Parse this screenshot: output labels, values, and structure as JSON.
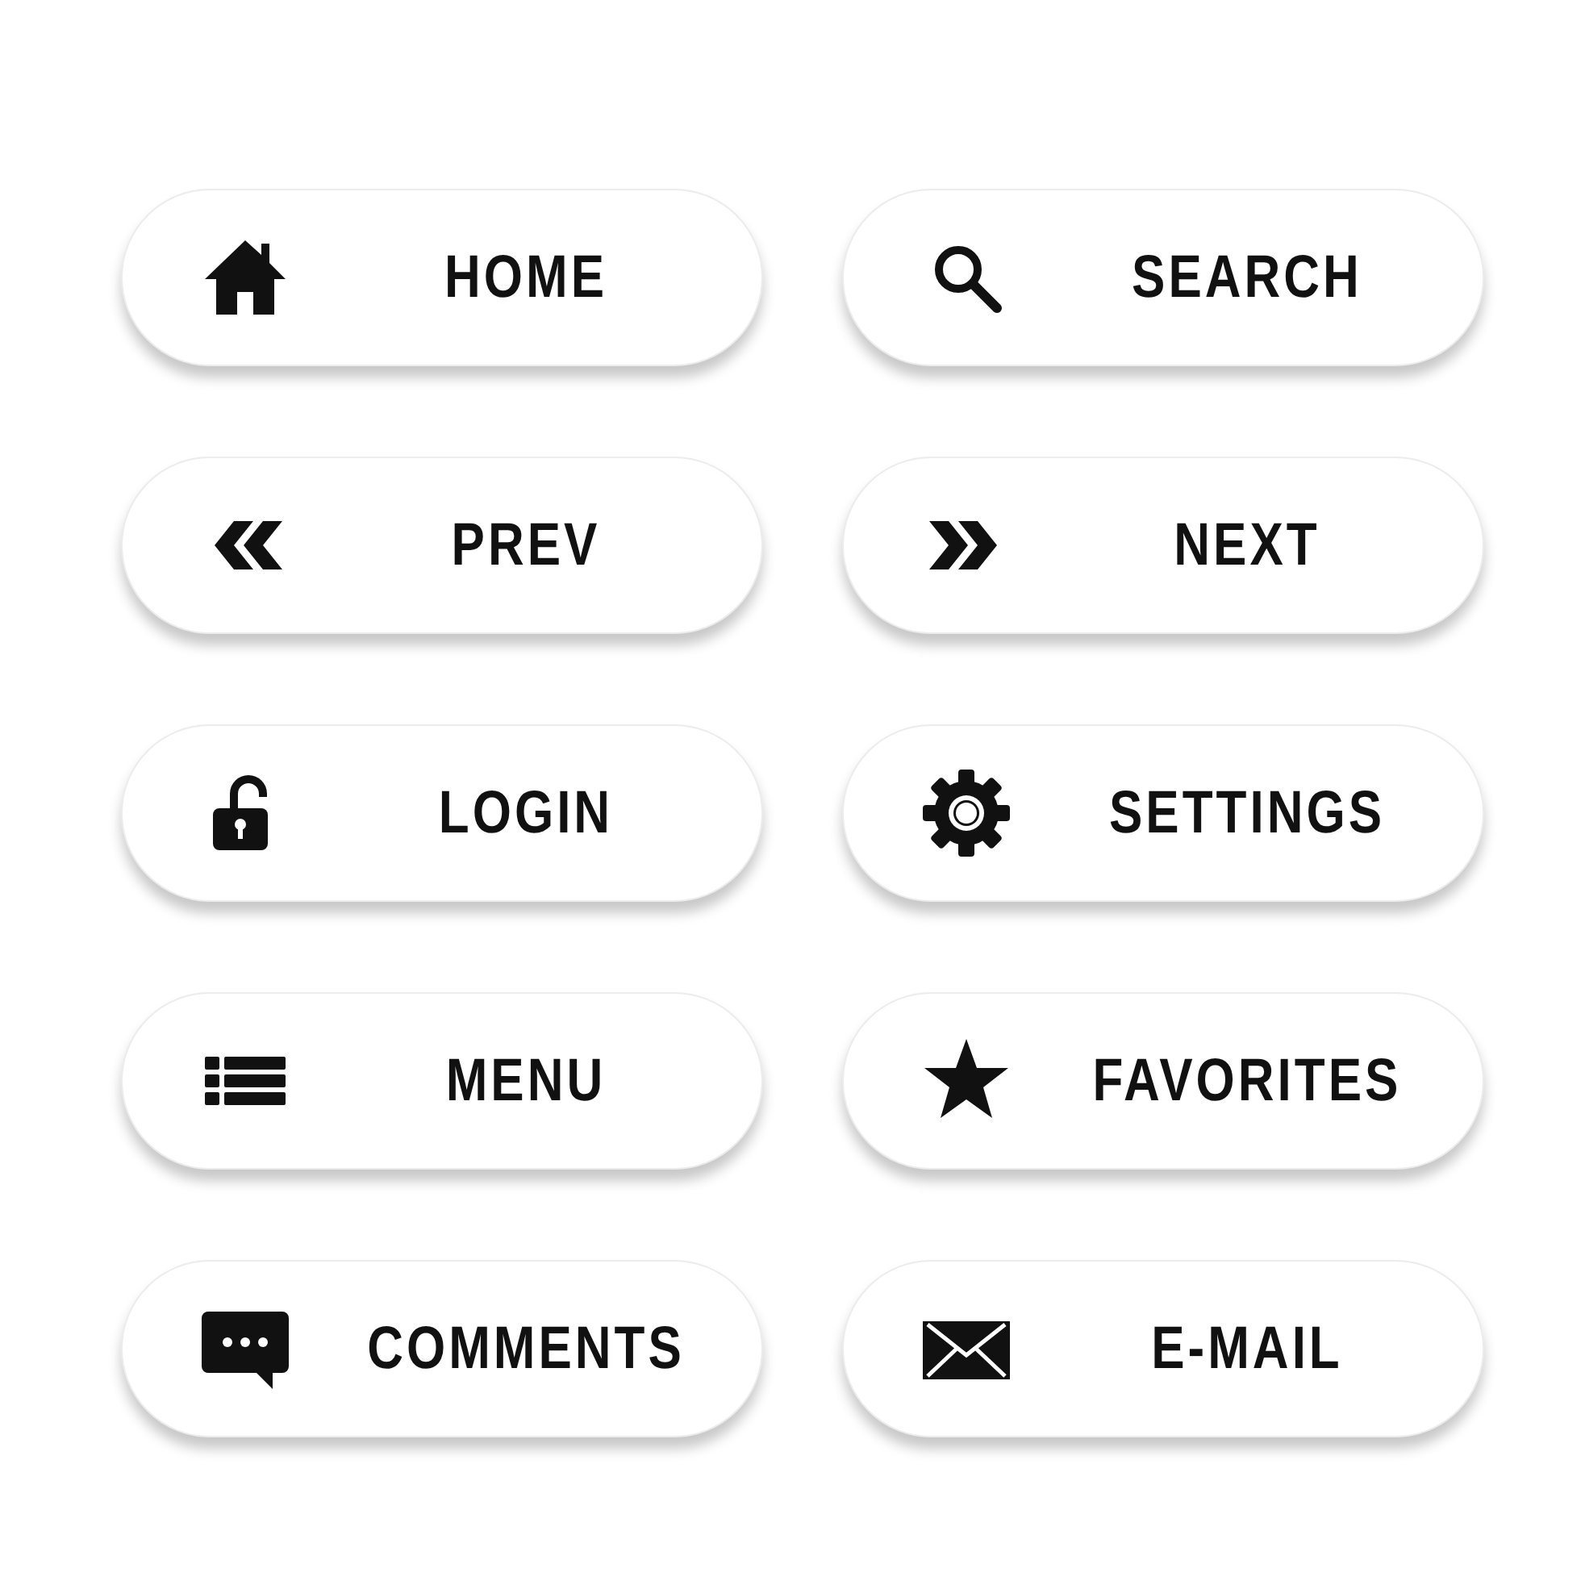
{
  "buttons": [
    {
      "label": "HOME"
    },
    {
      "label": "SEARCH"
    },
    {
      "label": "PREV"
    },
    {
      "label": "NEXT"
    },
    {
      "label": "LOGIN"
    },
    {
      "label": "SETTINGS"
    },
    {
      "label": "MENU"
    },
    {
      "label": "FAVORITES"
    },
    {
      "label": "COMMENTS"
    },
    {
      "label": "E-MAIL"
    }
  ]
}
